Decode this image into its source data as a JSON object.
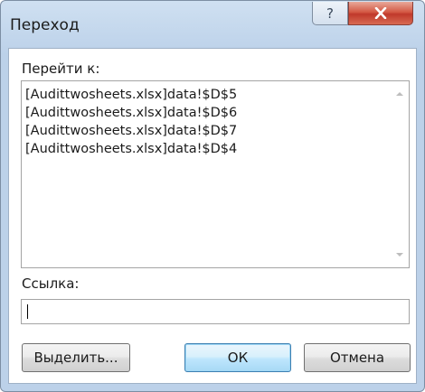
{
  "window": {
    "title": "Переход"
  },
  "titlebar": {
    "help_glyph": "?",
    "help_icon": "question-mark-icon",
    "close_icon": "close-x-icon"
  },
  "goto": {
    "label": "Перейти к:",
    "items": [
      "[Audittwosheets.xlsx]data!$D$5",
      "[Audittwosheets.xlsx]data!$D$6",
      "[Audittwosheets.xlsx]data!$D$7",
      "[Audittwosheets.xlsx]data!$D$4"
    ]
  },
  "reference": {
    "label": "Ссылка:",
    "value": ""
  },
  "buttons": {
    "select": "Выделить...",
    "ok": "ОК",
    "cancel": "Отмена"
  },
  "colors": {
    "titlebar": "#c2d6ec",
    "close_button": "#c0392b",
    "default_button_border": "#3c7fb1"
  }
}
